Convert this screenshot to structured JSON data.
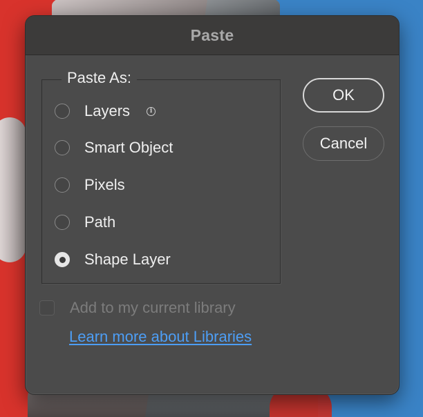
{
  "dialog": {
    "title": "Paste",
    "group_label": "Paste As:",
    "options": [
      {
        "label": "Layers",
        "selected": false,
        "has_info": true
      },
      {
        "label": "Smart Object",
        "selected": false
      },
      {
        "label": "Pixels",
        "selected": false
      },
      {
        "label": "Path",
        "selected": false
      },
      {
        "label": "Shape Layer",
        "selected": true
      }
    ],
    "info_glyph": "i",
    "buttons": {
      "ok_label": "OK",
      "cancel_label": "Cancel"
    },
    "library_checkbox": {
      "label": "Add to my current library",
      "checked": false,
      "enabled": false
    },
    "learn_more_link": "Learn more about Libraries"
  },
  "icons": {
    "info": "info-circle-icon"
  },
  "colors": {
    "dialog_bg": "#4b4b4b",
    "titlebar_bg": "#3c3b3a",
    "link": "#4d9ef5",
    "backdrop_red": "#d8332c",
    "backdrop_blue": "#3a83c6"
  }
}
